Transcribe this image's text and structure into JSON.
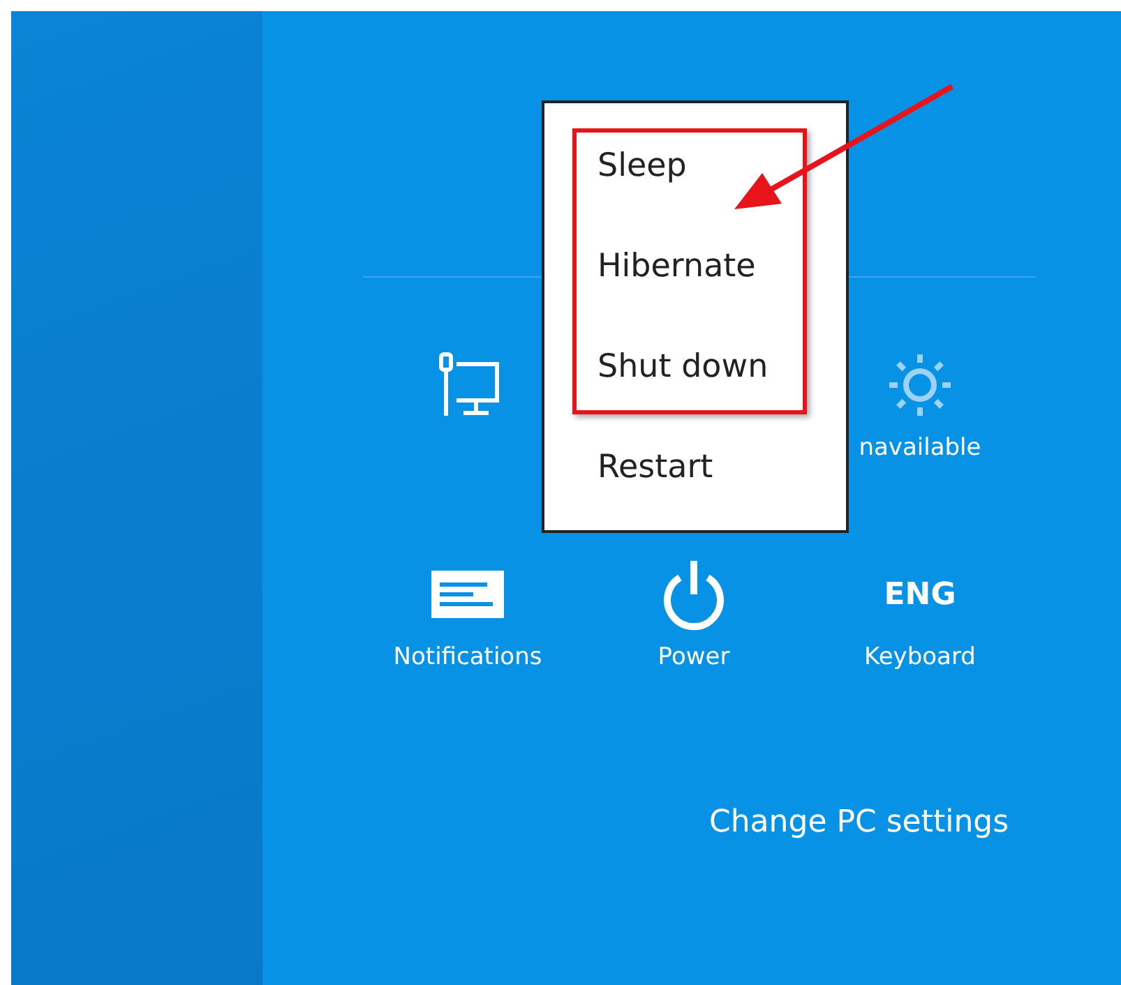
{
  "settings_panel": {
    "tile_rows": [
      [
        {
          "kind": "network",
          "disabled": false
        },
        {
          "kind": "brightness",
          "label": "navailable",
          "disabled": true
        }
      ],
      [
        {
          "kind": "notifications",
          "label": "Notifications",
          "disabled": false
        },
        {
          "kind": "power",
          "label": "Power",
          "disabled": false
        },
        {
          "kind": "keyboard",
          "icon_text": "ENG",
          "label": "Keyboard",
          "disabled": false
        }
      ]
    ],
    "link": "Change PC settings"
  },
  "power_menu": {
    "items": [
      {
        "label": "Sleep"
      },
      {
        "label": "Hibernate"
      },
      {
        "label": "Shut down"
      },
      {
        "label": "Restart"
      }
    ]
  }
}
